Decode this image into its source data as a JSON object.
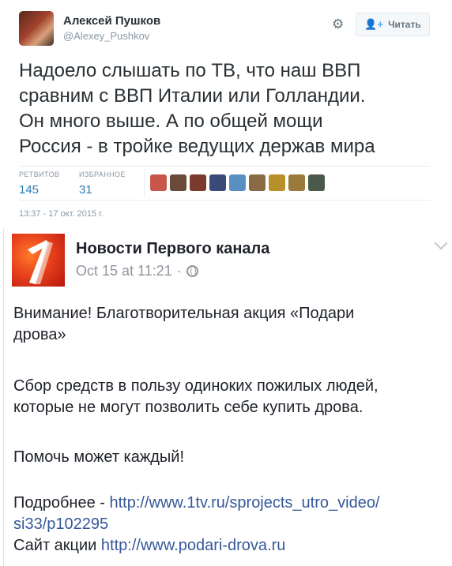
{
  "tweet": {
    "author_name": "Алексей Пушков",
    "author_handle": "@Alexey_Pushkov",
    "follow_label": "Читать",
    "text_lines": [
      "Надоело слышать по ТВ, что наш ВВП",
      "сравним с ВВП Италии или Голландии.",
      "Он много выше. А по общей мощи",
      "Россия - в тройке ведущих держав мира"
    ],
    "retweets_label": "РЕТВИТОВ",
    "retweets_count": "145",
    "favorites_label": "ИЗБРАННОЕ",
    "favorites_count": "31",
    "timestamp": "13:37 - 17 окт. 2015 г.",
    "mini_avatar_colors": [
      "#c9564a",
      "#6b4a3a",
      "#7a3b2e",
      "#3b4a78",
      "#5a8fc2",
      "#8a6a45",
      "#b8902a",
      "#9a7a3a",
      "#4a5a4a"
    ]
  },
  "fb_post": {
    "page_name": "Новости Первого канала",
    "date": "Oct 15 at 11:21",
    "separator": "·",
    "paragraph1_lines": [
      "Внимание! Благотворительная акция «Подари",
      "дрова»"
    ],
    "paragraph2_lines": [
      "Сбор средств в пользу одиноких пожилых людей,",
      "которые не могут позволить себе купить дрова."
    ],
    "paragraph3": "Помочь может каждый!",
    "details_label": "Подробнее - ",
    "details_link_line1": "http://www.1tv.ru/sprojects_utro_video/",
    "details_link_line2": "si33/p102295",
    "site_label": "Сайт акции ",
    "site_link": "http://www.podari-drova.ru"
  }
}
